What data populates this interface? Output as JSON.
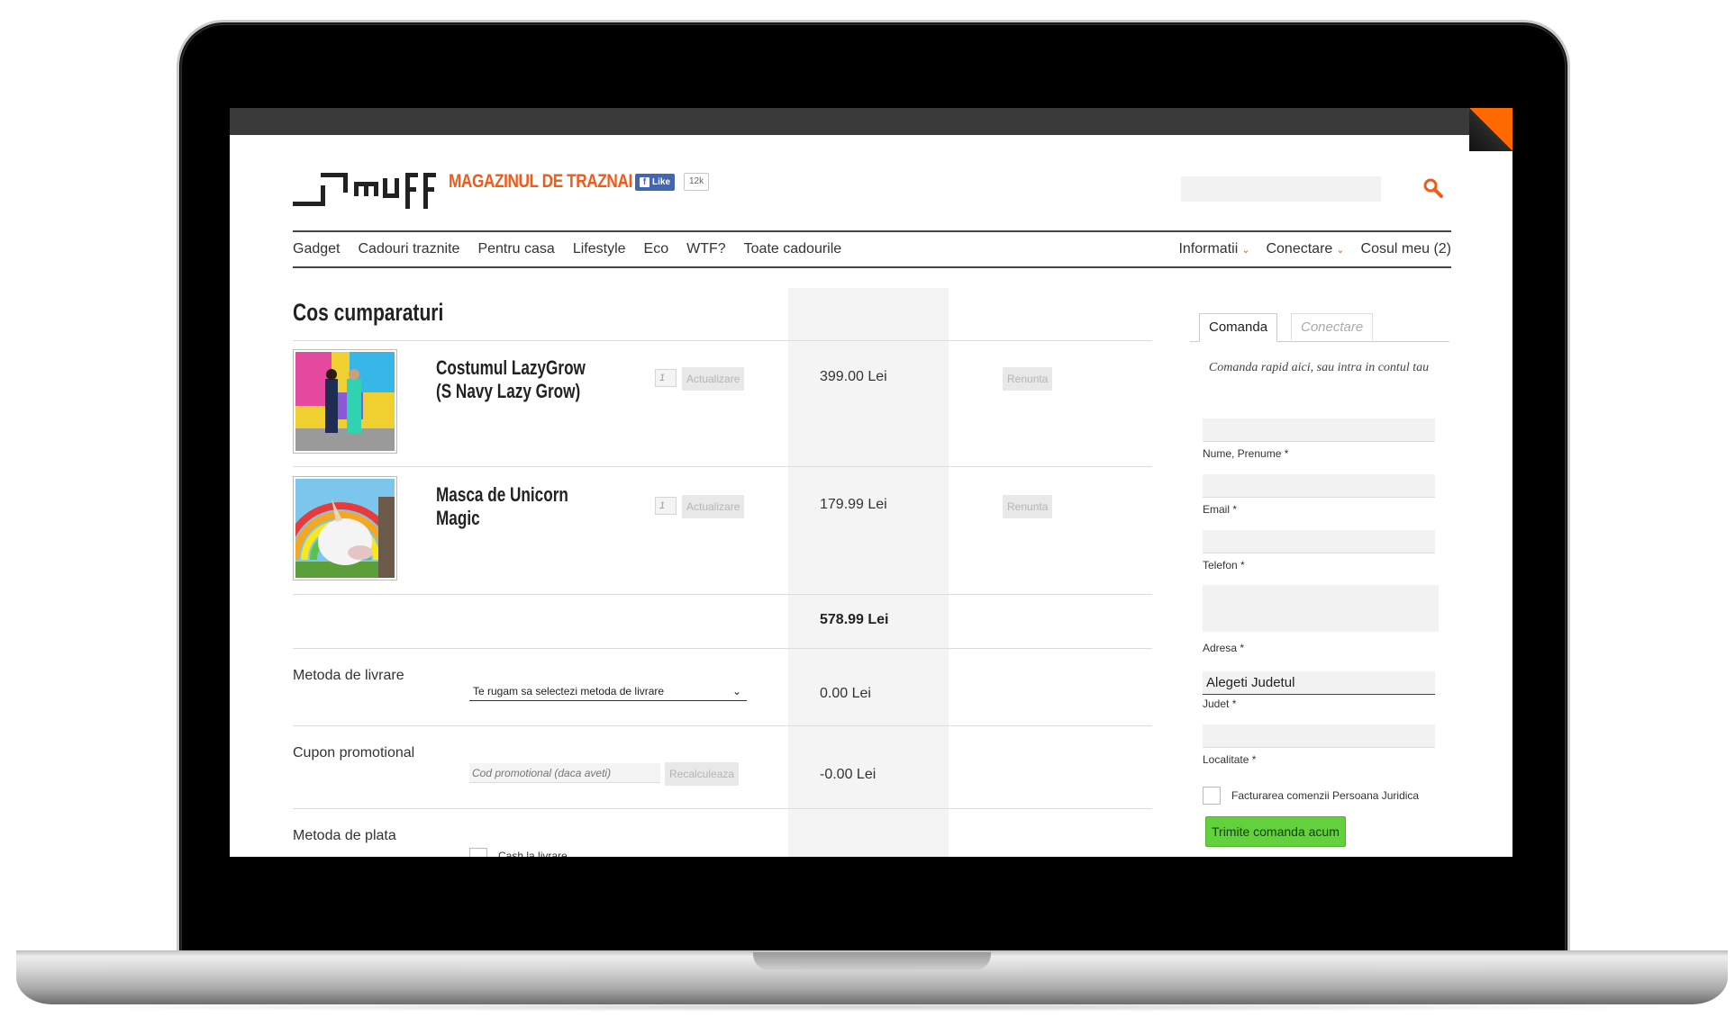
{
  "site": {
    "tagline": "MAGAZINUL DE TRAZNAI",
    "accent_color": "#f05a1a",
    "fb_like_label": "Like",
    "fb_like_count": "12k",
    "search_icon": "search-icon"
  },
  "nav": {
    "left": [
      "Gadget",
      "Cadouri traznite",
      "Pentru casa",
      "Lifestyle",
      "Eco",
      "WTF?",
      "Toate cadourile"
    ],
    "right": [
      {
        "label": "Informatii",
        "has_dropdown": true
      },
      {
        "label": "Conectare",
        "has_dropdown": true
      },
      {
        "label": "Cosul meu (2)",
        "has_dropdown": false
      }
    ]
  },
  "cart": {
    "title": "Cos cumparaturi",
    "items": [
      {
        "name": "Costumul LazyGrow (S Navy Lazy Grow)",
        "qty": "1",
        "update_label": "Actualizare",
        "price": "399.00 Lei",
        "remove_label": "Renunta"
      },
      {
        "name": "Masca de Unicorn Magic",
        "qty": "1",
        "update_label": "Actualizare",
        "price": "179.99 Lei",
        "remove_label": "Renunta"
      }
    ],
    "subtotal": "578.99 Lei",
    "delivery": {
      "label": "Metoda de livrare",
      "select_value": "Te rugam sa selectezi metoda de livrare",
      "price": "0.00 Lei"
    },
    "coupon": {
      "label": "Cupon promotional",
      "placeholder": "Cod promotional (daca aveti)",
      "button": "Recalculeaza",
      "price": "-0.00 Lei"
    },
    "payment": {
      "label": "Metoda de plata",
      "option": "Cash la livrare"
    }
  },
  "order_panel": {
    "tab_active": "Comanda",
    "tab_inactive": "Conectare",
    "intro": "Comanda rapid aici, sau intra in contul tau",
    "fields": {
      "name": "Nume, Prenume *",
      "email": "Email *",
      "phone": "Telefon *",
      "address": "Adresa *",
      "county_value": "Alegeti Judetul",
      "county": "Judet *",
      "city": "Localitate *"
    },
    "company_checkbox": "Facturarea comenzii Persoana Juridica",
    "submit": "Trimite comanda acum",
    "submit_color": "#63d13e"
  }
}
